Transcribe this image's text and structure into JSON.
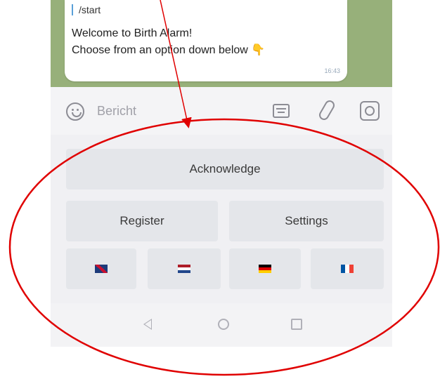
{
  "message": {
    "reply_text": "/start",
    "line1": "Welcome to Birth Alarm!",
    "line2": "Choose from an option down below",
    "time": "16:43"
  },
  "input": {
    "placeholder": "Bericht"
  },
  "keyboard": {
    "acknowledge_label": "Acknowledge",
    "register_label": "Register",
    "settings_label": "Settings"
  },
  "icons": {
    "emoji": "emoji-icon",
    "commands": "bot-command-icon",
    "attach": "paperclip-icon",
    "camera": "camera-icon",
    "hand": "pointing-down-hand-emoji",
    "nav_back": "back-triangle-icon",
    "nav_home": "home-circle-icon",
    "nav_recent": "recents-square-icon"
  },
  "flags": [
    "uk-flag",
    "netherlands-flag",
    "germany-flag",
    "france-flag"
  ],
  "colors": {
    "chat_background": "#97b07a",
    "annotation_red": "#e00000",
    "button_bg": "#e4e6ea"
  }
}
